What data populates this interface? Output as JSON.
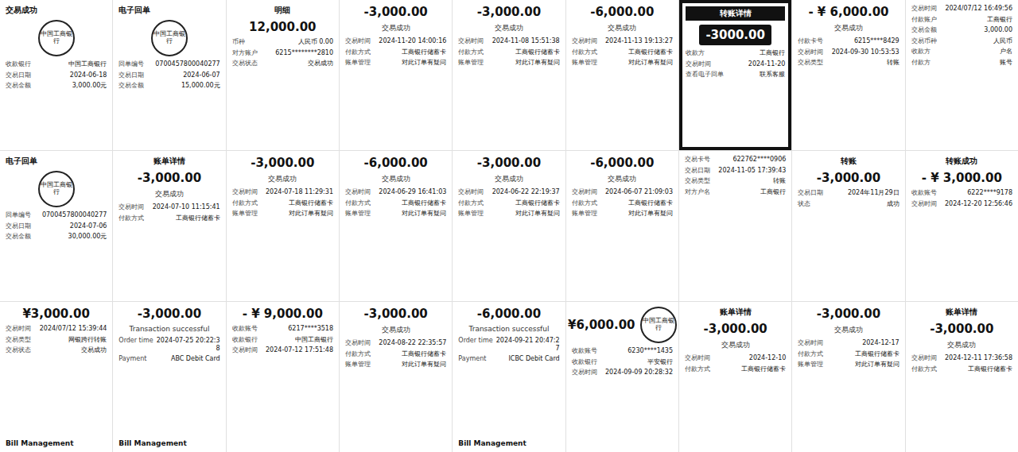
{
  "collage": {
    "tiles": [
      {
        "kind": "receipt",
        "header": "交易成功",
        "stamp": "中国工商银行",
        "rows": [
          {
            "label": "收款银行",
            "value": "中国工商银行"
          },
          {
            "label": "交易日期",
            "value": "2024-06-18"
          },
          {
            "label": "交易金额",
            "value": "3,000.00元"
          }
        ]
      },
      {
        "kind": "receipt",
        "header": "电子回单",
        "stamp": "中国工商银行",
        "rows": [
          {
            "label": "回单编号",
            "value": "0700457800040277"
          },
          {
            "label": "交易日期",
            "value": "2024-06-07"
          },
          {
            "label": "交易金额",
            "value": "15,000.00元"
          }
        ]
      },
      {
        "kind": "detail",
        "header": "明细",
        "amount": "12,000.00",
        "rows": [
          {
            "label": "币种",
            "value": "人民币 0.00"
          },
          {
            "label": "对方账户",
            "value": "6215********2810"
          },
          {
            "label": "交易状态",
            "value": "交易成功"
          }
        ]
      },
      {
        "kind": "detail",
        "amount": "-3,000.00",
        "status": "交易成功",
        "rows": [
          {
            "label": "交易时间",
            "value": "2024-11-20 14:00:16"
          },
          {
            "label": "付款方式",
            "value": "工商银行储蓄卡"
          },
          {
            "label": "账单管理",
            "value": "对此订单有疑问"
          }
        ]
      },
      {
        "kind": "detail",
        "amount": "-3,000.00",
        "status": "交易成功",
        "rows": [
          {
            "label": "交易时间",
            "value": "2024-11-08 15:51:38"
          },
          {
            "label": "付款方式",
            "value": "工商银行储蓄卡"
          },
          {
            "label": "账单管理",
            "value": "对此订单有疑问"
          }
        ]
      },
      {
        "kind": "detail",
        "amount": "-6,000.00",
        "status": "交易成功",
        "rows": [
          {
            "label": "交易时间",
            "value": "2024-11-13 19:13:27"
          },
          {
            "label": "付款方式",
            "value": "工商银行储蓄卡"
          },
          {
            "label": "账单管理",
            "value": "对此订单有疑问"
          }
        ]
      },
      {
        "kind": "framed",
        "header": "转账详情",
        "amount": "-3000.00",
        "rows": [
          {
            "label": "收款方",
            "value": "工商银行"
          },
          {
            "label": "交易时间",
            "value": "2024-11-20"
          },
          {
            "label": "查看电子回单",
            "value": "联系客服"
          }
        ]
      },
      {
        "kind": "detail",
        "amount": "- ¥ 6,000.00",
        "status": "交易成功",
        "rows": [
          {
            "label": "付款卡号",
            "value": "6215****8429"
          },
          {
            "label": "交易时间",
            "value": "2024-09-30 10:53:53"
          },
          {
            "label": "交易类型",
            "value": "转账"
          }
        ]
      },
      {
        "kind": "list",
        "rows": [
          {
            "label": "交易时间",
            "value": "2024/07/12 16:49:56"
          },
          {
            "label": "付款账户",
            "value": "工商银行"
          },
          {
            "label": "交易金额",
            "value": "3,000.00"
          },
          {
            "label": "交易币种",
            "value": "人民币"
          },
          {
            "label": "收款方",
            "value": "户名"
          },
          {
            "label": "付款方",
            "value": "账号"
          }
        ]
      },
      {
        "kind": "receipt",
        "header": "电子回单",
        "stamp": "中国工商银行",
        "rows": [
          {
            "label": "回单编号",
            "value": "0700457800040277"
          },
          {
            "label": "交易日期",
            "value": "2024-07-06"
          },
          {
            "label": "交易金额",
            "value": "30,000.00元"
          }
        ]
      },
      {
        "kind": "detail",
        "header": "账单详情",
        "amount": "-3,000.00",
        "status": "交易成功",
        "rows": [
          {
            "label": "交易时间",
            "value": "2024-07-10 11:15:41"
          },
          {
            "label": "付款方式",
            "value": "工商银行储蓄卡"
          }
        ]
      },
      {
        "kind": "detail",
        "amount": "-3,000.00",
        "status": "交易成功",
        "rows": [
          {
            "label": "交易时间",
            "value": "2024-07-18 11:29:31"
          },
          {
            "label": "付款方式",
            "value": "工商银行储蓄卡"
          },
          {
            "label": "账单管理",
            "value": "对此订单有疑问"
          }
        ]
      },
      {
        "kind": "detail",
        "amount": "-6,000.00",
        "status": "交易成功",
        "rows": [
          {
            "label": "交易时间",
            "value": "2024-06-29 16:41:03"
          },
          {
            "label": "付款方式",
            "value": "工商银行储蓄卡"
          },
          {
            "label": "账单管理",
            "value": "对此订单有疑问"
          }
        ]
      },
      {
        "kind": "detail",
        "amount": "-3,000.00",
        "status": "交易成功",
        "rows": [
          {
            "label": "交易时间",
            "value": "2024-06-22 22:19:37"
          },
          {
            "label": "付款方式",
            "value": "工商银行储蓄卡"
          },
          {
            "label": "账单管理",
            "value": "对此订单有疑问"
          }
        ]
      },
      {
        "kind": "detail",
        "amount": "-6,000.00",
        "status": "交易成功",
        "rows": [
          {
            "label": "交易时间",
            "value": "2024-06-07 21:09:03"
          },
          {
            "label": "付款方式",
            "value": "工商银行储蓄卡"
          },
          {
            "label": "账单管理",
            "value": "对此订单有疑问"
          }
        ]
      },
      {
        "kind": "list",
        "rows": [
          {
            "label": "交易卡号",
            "value": "622762****0906"
          },
          {
            "label": "交易日期",
            "value": "2024-11-05 17:39:43"
          },
          {
            "label": "交易类型",
            "value": "转账"
          },
          {
            "label": "对方户名",
            "value": "工商银行"
          }
        ]
      },
      {
        "kind": "detail",
        "header": "转账",
        "amount": "-3,000.00",
        "rows": [
          {
            "label": "交易日期",
            "value": "2024年11月29日"
          },
          {
            "label": "状态",
            "value": "成功"
          }
        ]
      },
      {
        "kind": "detail",
        "header": "转账成功",
        "amount": "- ¥ 3,000.00",
        "rows": [
          {
            "label": "收款账号",
            "value": "6222****9178"
          },
          {
            "label": "交易时间",
            "value": "2024-12-20 12:56:46"
          }
        ]
      },
      {
        "kind": "detail",
        "amount": "¥3,000.00",
        "rows": [
          {
            "label": "交易时间",
            "value": "2024/07/12 15:39:44"
          },
          {
            "label": "交易类型",
            "value": "网银跨行转账"
          },
          {
            "label": "交易状态",
            "value": "交易成功"
          }
        ],
        "footer": "Bill Management"
      },
      {
        "kind": "detail",
        "amount": "-3,000.00",
        "status": "Transaction successful",
        "rows": [
          {
            "label": "Order time",
            "value": "2024-07-25 20:22:38"
          },
          {
            "label": "Payment",
            "value": "ABC Debit Card"
          }
        ],
        "footer": "Bill Management"
      },
      {
        "kind": "detail",
        "amount": "- ¥ 9,000.00",
        "rows": [
          {
            "label": "收款账号",
            "value": "6217****3518"
          },
          {
            "label": "收款银行",
            "value": "中国工商银行"
          },
          {
            "label": "交易时间",
            "value": "2024-07-12 17:51:48"
          }
        ]
      },
      {
        "kind": "detail",
        "amount": "-3,000.00",
        "status": "交易成功",
        "rows": [
          {
            "label": "交易时间",
            "value": "2024-08-22 22:35:57"
          },
          {
            "label": "付款方式",
            "value": "工商银行储蓄卡"
          },
          {
            "label": "账单管理",
            "value": "对此订单有疑问"
          }
        ]
      },
      {
        "kind": "detail",
        "amount": "-6,000.00",
        "status": "Transaction successful",
        "rows": [
          {
            "label": "Order time",
            "value": "2024-09-21 20:47:27"
          },
          {
            "label": "Payment",
            "value": "ICBC Debit Card"
          }
        ],
        "footer": "Bill Management"
      },
      {
        "kind": "detail",
        "amount": "¥6,000.00",
        "stamp": "中国工商银行",
        "rows": [
          {
            "label": "收款账号",
            "value": "6230****1435"
          },
          {
            "label": "收款银行",
            "value": "平安银行"
          },
          {
            "label": "交易时间",
            "value": "2024-09-09 20:28:32"
          }
        ]
      },
      {
        "kind": "detail",
        "header": "账单详情",
        "amount": "-3,000.00",
        "status": "交易成功",
        "rows": [
          {
            "label": "交易时间",
            "value": "2024-12-10"
          },
          {
            "label": "付款方式",
            "value": "工商银行储蓄卡"
          }
        ]
      },
      {
        "kind": "detail",
        "amount": "-3,000.00",
        "status": "交易成功",
        "rows": [
          {
            "label": "交易时间",
            "value": "2024-12-17"
          },
          {
            "label": "付款方式",
            "value": "工商银行储蓄卡"
          },
          {
            "label": "账单管理",
            "value": "对此订单有疑问"
          }
        ]
      },
      {
        "kind": "detail",
        "header": "账单详情",
        "amount": "-3,000.00",
        "status": "交易成功",
        "rows": [
          {
            "label": "交易时间",
            "value": "2024-12-11 17:36:58"
          },
          {
            "label": "付款方式",
            "value": "工商银行储蓄卡"
          }
        ]
      }
    ]
  }
}
